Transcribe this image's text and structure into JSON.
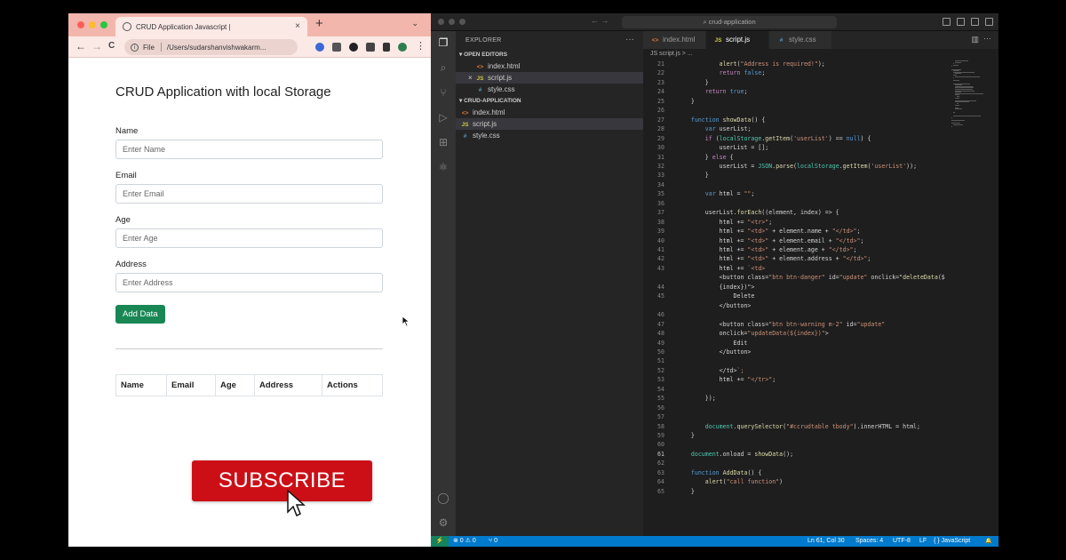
{
  "browser": {
    "tab_title": "CRUD Application Javascript |",
    "tab_close": "×",
    "new_tab": "+",
    "tab_menu": "⌄",
    "url_scheme": "File",
    "url_path": "/Users/sudarshanvishwakarm...",
    "nav_back": "←",
    "nav_forward": "→",
    "nav_reload": "C",
    "menu_dots": "⋮",
    "colors": {
      "tabbar": "#f3b6ad",
      "toolbar": "#fbe9e6"
    }
  },
  "app": {
    "title": "CRUD Application with local Storage",
    "fields": [
      {
        "label": "Name",
        "placeholder": "Enter Name"
      },
      {
        "label": "Email",
        "placeholder": "Enter Email"
      },
      {
        "label": "Age",
        "placeholder": "Enter Age"
      },
      {
        "label": "Address",
        "placeholder": "Enter Address"
      }
    ],
    "add_button": "Add Data",
    "table_headers": [
      "Name",
      "Email",
      "Age",
      "Address",
      "Actions"
    ],
    "colors": {
      "add_button": "#198754"
    }
  },
  "overlay": {
    "subscribe": "SUBSCRIBE",
    "subscribe_color": "#cc0f16"
  },
  "vscode": {
    "search": "crud-application",
    "explorer_title": "EXPLORER",
    "explorer_more": "···",
    "open_editors": "OPEN EDITORS",
    "open_files": [
      {
        "name": "index.html",
        "type": "html",
        "icon": "<>"
      },
      {
        "name": "script.js",
        "type": "js",
        "icon": "JS",
        "active": true,
        "close": "×"
      },
      {
        "name": "style.css",
        "type": "css",
        "icon": "#"
      }
    ],
    "folder": "CRUD-APPLICATION",
    "folder_files": [
      {
        "name": "index.html",
        "type": "html",
        "icon": "<>"
      },
      {
        "name": "script.js",
        "type": "js",
        "icon": "JS",
        "active": true
      },
      {
        "name": "style.css",
        "type": "css",
        "icon": "#"
      }
    ],
    "tabs": [
      {
        "name": "index.html",
        "icon": "<>"
      },
      {
        "name": "script.js",
        "icon": "JS",
        "active": true
      },
      {
        "name": "style.css",
        "icon": "#"
      }
    ],
    "breadcrumb": "JS script.js > ...",
    "current_line": 61,
    "code": [
      {
        "n": 21,
        "t": "            alert(\"Address is required!\");"
      },
      {
        "n": 22,
        "t": "            return false;"
      },
      {
        "n": 23,
        "t": "        }"
      },
      {
        "n": 24,
        "t": "        return true;"
      },
      {
        "n": 25,
        "t": "    }"
      },
      {
        "n": 26,
        "t": ""
      },
      {
        "n": 27,
        "t": "    function showData() {"
      },
      {
        "n": 28,
        "t": "        var userList;"
      },
      {
        "n": 29,
        "t": "        if (localStorage.getItem('userList') == null) {"
      },
      {
        "n": 30,
        "t": "            userList = [];"
      },
      {
        "n": 31,
        "t": "        } else {"
      },
      {
        "n": 32,
        "t": "            userList = JSON.parse(localStorage.getItem('userList'));"
      },
      {
        "n": 33,
        "t": "        }"
      },
      {
        "n": 34,
        "t": ""
      },
      {
        "n": 35,
        "t": "        var html = \"\";"
      },
      {
        "n": 36,
        "t": ""
      },
      {
        "n": 37,
        "t": "        userList.forEach((element, index) => {"
      },
      {
        "n": 38,
        "t": "            html += \"<tr>\";"
      },
      {
        "n": 39,
        "t": "            html += \"<td>\" + element.name + \"</td>\";"
      },
      {
        "n": 40,
        "t": "            html += \"<td>\" + element.email + \"</td>\";"
      },
      {
        "n": 41,
        "t": "            html += \"<td>\" + element.age + \"</td>\";"
      },
      {
        "n": 42,
        "t": "            html += \"<td>\" + element.address + \"</td>\";"
      },
      {
        "n": 43,
        "t": "            html += `<td>"
      },
      {
        "n": "",
        "t": "            <button class=\"btn btn-danger\" id=\"update\" onclick=\"deleteData($"
      },
      {
        "n": 44,
        "t": "            {index})\">"
      },
      {
        "n": 45,
        "t": "                Delete"
      },
      {
        "n": "",
        "t": "            </button>"
      },
      {
        "n": 46,
        "t": ""
      },
      {
        "n": 47,
        "t": "            <button class=\"btn btn-warning m-2\" id=\"update\""
      },
      {
        "n": 48,
        "t": "            onclick=\"updateData(${index})\">"
      },
      {
        "n": 49,
        "t": "                Edit"
      },
      {
        "n": 50,
        "t": "            </button>"
      },
      {
        "n": 51,
        "t": ""
      },
      {
        "n": 52,
        "t": "            </td>`;"
      },
      {
        "n": 53,
        "t": "            html += \"</tr>\";"
      },
      {
        "n": 54,
        "t": ""
      },
      {
        "n": 55,
        "t": "        });"
      },
      {
        "n": 56,
        "t": ""
      },
      {
        "n": 57,
        "t": ""
      },
      {
        "n": 58,
        "t": "        document.querySelector(\"#ccrudtable tbody\").innerHTML = html;"
      },
      {
        "n": 59,
        "t": "    }"
      },
      {
        "n": 60,
        "t": ""
      },
      {
        "n": 61,
        "t": "    document.onload = showData();"
      },
      {
        "n": 62,
        "t": ""
      },
      {
        "n": 63,
        "t": "    function AddData() {"
      },
      {
        "n": 64,
        "t": "        alert(\"call function\")"
      },
      {
        "n": 65,
        "t": "    }"
      }
    ],
    "status": {
      "remote": "⚡",
      "problems": "⊗ 0 ⚠ 0",
      "ports": "⑂ 0",
      "position": "Ln 61, Col 30",
      "spaces": "Spaces: 4",
      "encoding": "UTF-8",
      "eol": "LF",
      "language": "{ } JavaScript",
      "bell": "🔔"
    },
    "colors": {
      "status_bar": "#007acc",
      "sidebar": "#252526",
      "editor": "#1e1e1e"
    }
  }
}
